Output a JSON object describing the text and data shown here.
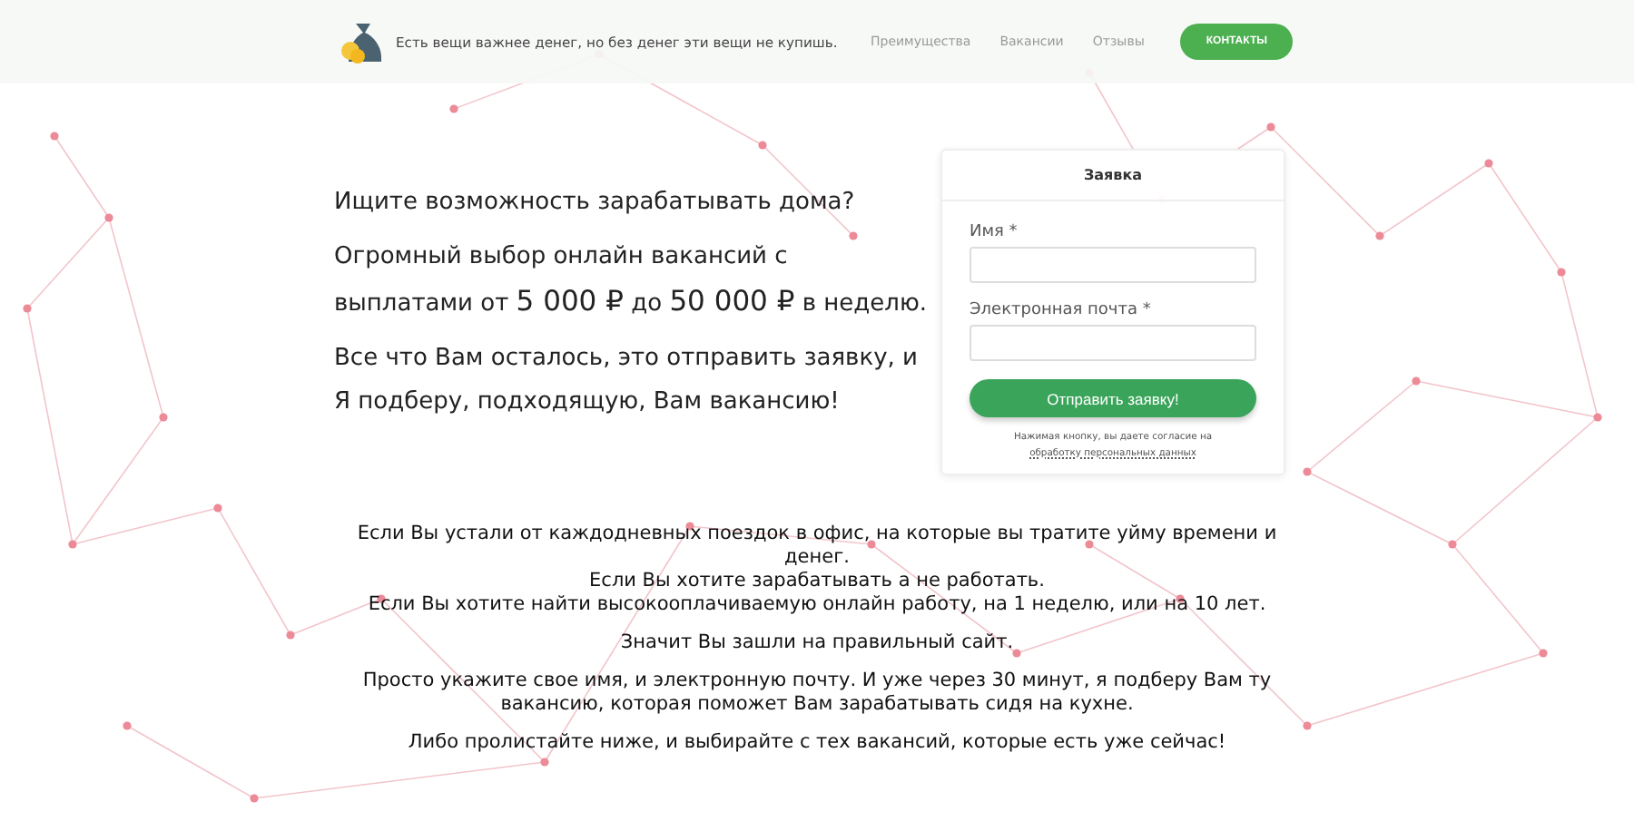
{
  "header": {
    "slogan": "Есть вещи важнее денег, но без денег эти вещи не купишь.",
    "nav": [
      "Преимущества",
      "Вакансии",
      "Отзывы"
    ],
    "contact_button": "КОНТАКТЫ"
  },
  "intro": [
    "Ищите возможность зарабатывать дома?",
    "Огромный выбор онлайн вакансий с выплатами от **5 000 ₽** до **50 000 ₽** в неделю.",
    "Все что Вам осталось, это отправить заявку, и Я подберу, подходящую, Вам вакансию!"
  ],
  "form": {
    "title": "Заявка",
    "fields": [
      {
        "label": "Имя *"
      },
      {
        "label": "Электронная почта *"
      }
    ],
    "submit": "Отправить заявку!",
    "consent": "Нажимая кнопку, вы даете согласие на",
    "consent_link": "обработку персональных данных"
  },
  "body": [
    [
      "Если Вы устали от каждодневных поездок в офис, на которые вы тратите уйму времени и денег.",
      "Если Вы хотите зарабатывать а не работать.",
      "Если Вы хотите найти высокооплачиваемую онлайн работу, на 1 неделю, или на 10 лет."
    ],
    [
      "Значит Вы зашли на правильный сайт."
    ],
    [
      "Просто укажите свое имя, и электронную почту. И уже через 30 минут, я подберу Вам ту вакансию, которая поможет Вам зарабатывать сидя на кухне."
    ],
    [
      "Либо пролистайте ниже, и выбирайте с тех вакансий, которые есть уже сейчас!"
    ]
  ]
}
